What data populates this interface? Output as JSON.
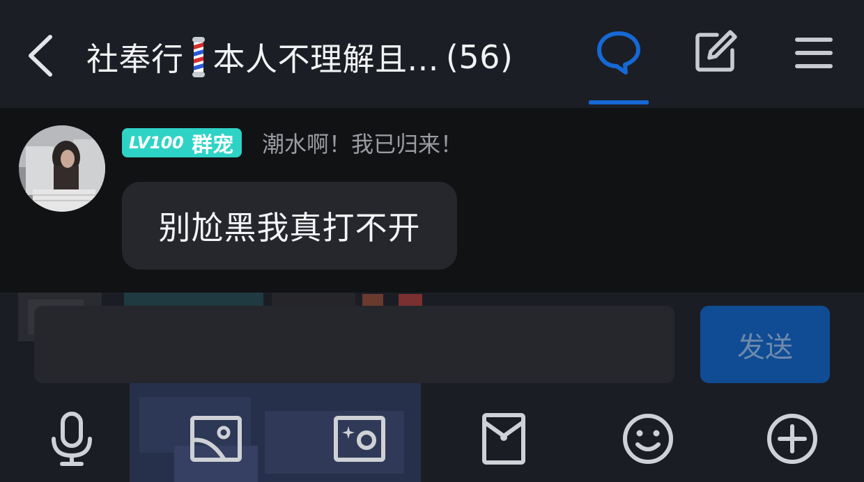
{
  "header": {
    "title_prefix": "社奉行",
    "title_suffix": "本人不理解且...",
    "member_count": "(56)",
    "back_icon": "chevron-left-icon",
    "chat_icon": "chat-bubble-icon",
    "edit_icon": "edit-square-icon",
    "menu_icon": "hamburger-menu-icon",
    "active_tab_color": "#1668d4"
  },
  "message": {
    "level_label": "LV100",
    "title_badge": "群宠",
    "badge_color": "#2ed3c6",
    "nickname": "潮水啊！我已归来！",
    "text": "别尬黑我真打不开"
  },
  "input": {
    "value": "",
    "send_label": "发送",
    "send_color": "#0f4c94"
  },
  "toolbar": {
    "items": [
      "microphone-icon",
      "image-icon",
      "camera-icon",
      "red-packet-icon",
      "emoji-icon",
      "plus-icon"
    ]
  }
}
